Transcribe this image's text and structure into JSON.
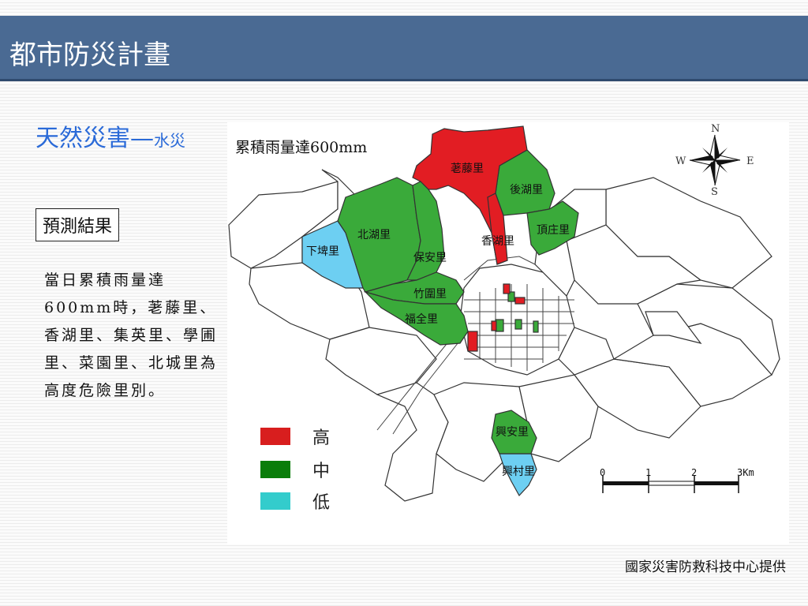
{
  "page": {
    "title": "都市防災計畫",
    "subtitle_main": "天然災害",
    "subtitle_dash": "—",
    "subtitle_small": "水災",
    "result_label": "預測結果",
    "description": "當日累積雨量達600mm時，荖藤里、香湖里、集英里、學圃里、菜園里、北城里為高度危險里別。",
    "credit": "國家災害防救科技中心提供"
  },
  "map": {
    "title": "累積雨量達600mm",
    "colors": {
      "high": "#e21d23",
      "medium": "#3aaa3a",
      "low": "#6dcff2",
      "outline": "#333333"
    },
    "villages": [
      {
        "name": "荖藤里",
        "risk": "high"
      },
      {
        "name": "後湖里",
        "risk": "medium"
      },
      {
        "name": "頂庄里",
        "risk": "medium"
      },
      {
        "name": "香湖里",
        "risk": "high"
      },
      {
        "name": "北湖里",
        "risk": "medium"
      },
      {
        "name": "保安里",
        "risk": "medium"
      },
      {
        "name": "竹圍里",
        "risk": "medium"
      },
      {
        "name": "福全里",
        "risk": "medium"
      },
      {
        "name": "下埤里",
        "risk": "low"
      },
      {
        "name": "興安里",
        "risk": "medium"
      },
      {
        "name": "興村里",
        "risk": "low"
      }
    ],
    "legend": [
      {
        "label": "高",
        "color": "#d81e1e"
      },
      {
        "label": "中",
        "color": "#0a7d0a"
      },
      {
        "label": "低",
        "color": "#33cccc"
      }
    ],
    "compass": {
      "n": "N",
      "s": "S",
      "e": "E",
      "w": "W"
    },
    "scale_labels": [
      "0",
      "1",
      "2",
      "3Km"
    ]
  }
}
